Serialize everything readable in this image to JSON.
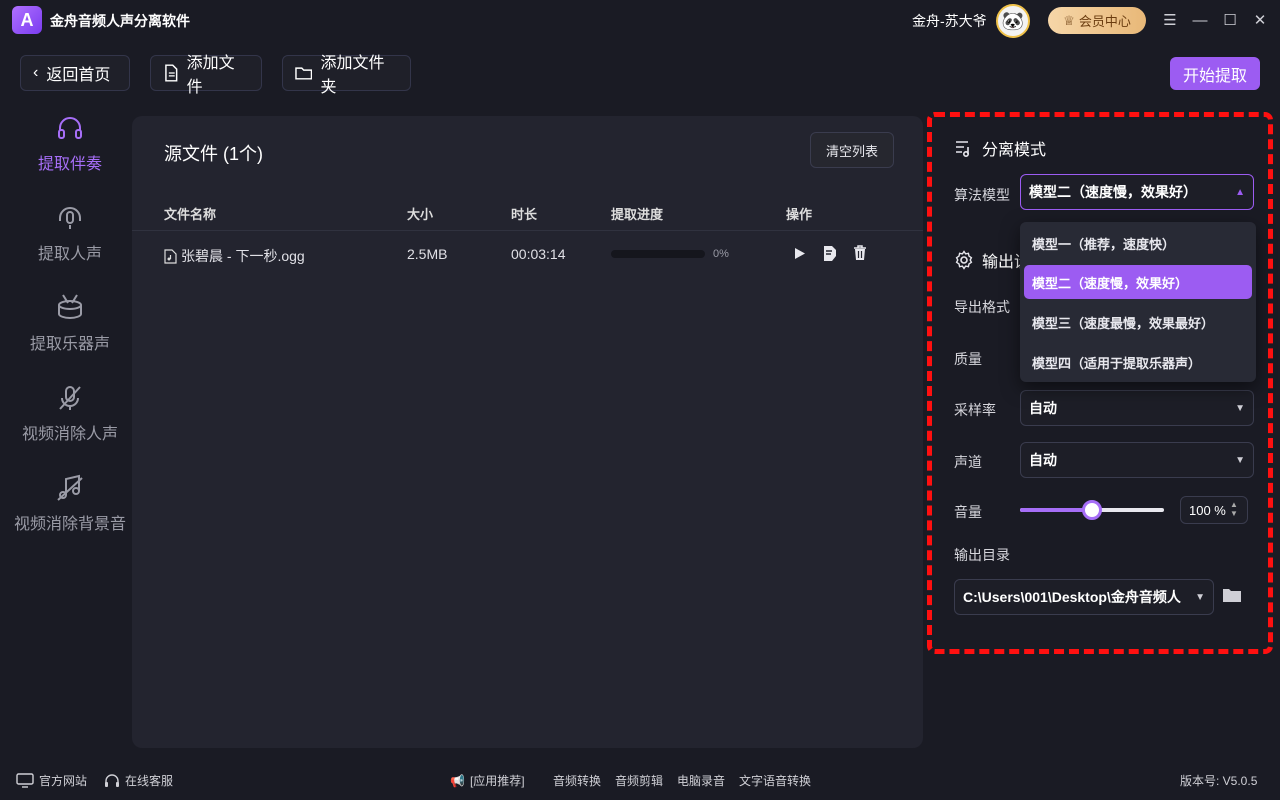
{
  "app": {
    "title": "金舟音频人声分离软件",
    "logo_letter": "A"
  },
  "user": {
    "name": "金舟-苏大爷"
  },
  "vip": {
    "label": "会员中心"
  },
  "toolbar": {
    "back_label": "返回首页",
    "add_file_label": "添加文件",
    "add_folder_label": "添加文件夹",
    "start_label": "开始提取"
  },
  "sidebar": {
    "items": [
      {
        "label": "提取伴奏",
        "icon": "headphones-icon",
        "active": true
      },
      {
        "label": "提取人声",
        "icon": "microphone-icon",
        "active": false
      },
      {
        "label": "提取乐器声",
        "icon": "drum-icon",
        "active": false
      },
      {
        "label": "视频消除人声",
        "icon": "mic-off-icon",
        "active": false
      },
      {
        "label": "视频消除背景音",
        "icon": "music-off-icon",
        "active": false
      }
    ]
  },
  "main": {
    "title": "源文件 (1个)",
    "clear_label": "清空列表",
    "columns": {
      "name": "文件名称",
      "size": "大小",
      "duration": "时长",
      "progress": "提取进度",
      "actions": "操作"
    },
    "rows": [
      {
        "name": "张碧晨 - 下一秒.ogg",
        "size": "2.5MB",
        "duration": "00:03:14",
        "progress_text": "0%",
        "progress": 0
      }
    ]
  },
  "separation": {
    "title": "分离模式",
    "model_label": "算法模型",
    "model_value": "模型二（速度慢，效果好）",
    "options": [
      "模型一（推荐，速度快）",
      "模型二（速度慢，效果好）",
      "模型三（速度最慢，效果最好）",
      "模型四（适用于提取乐器声）"
    ],
    "selected_index": 1
  },
  "output": {
    "title": "输出设",
    "format_label": "导出格式",
    "quality_label": "质量",
    "sample_rate_label": "采样率",
    "sample_rate_value": "自动",
    "channel_label": "声道",
    "channel_value": "自动",
    "volume_label": "音量",
    "volume_value": "100 %",
    "volume_fraction": 0.5,
    "dir_label": "输出目录",
    "dir_value": "C:\\Users\\001\\Desktop\\金舟音频人"
  },
  "footer": {
    "website": "官方网站",
    "support": "在线客服",
    "recommend": "[应用推荐]",
    "links": [
      "音频转换",
      "音频剪辑",
      "电脑录音",
      "文字语音转换"
    ],
    "version": "版本号: V5.0.5"
  },
  "colors": {
    "accent": "#9c5cf2",
    "highlight": "#ff1010",
    "background": "#1a1b24",
    "panel": "#23242f"
  }
}
